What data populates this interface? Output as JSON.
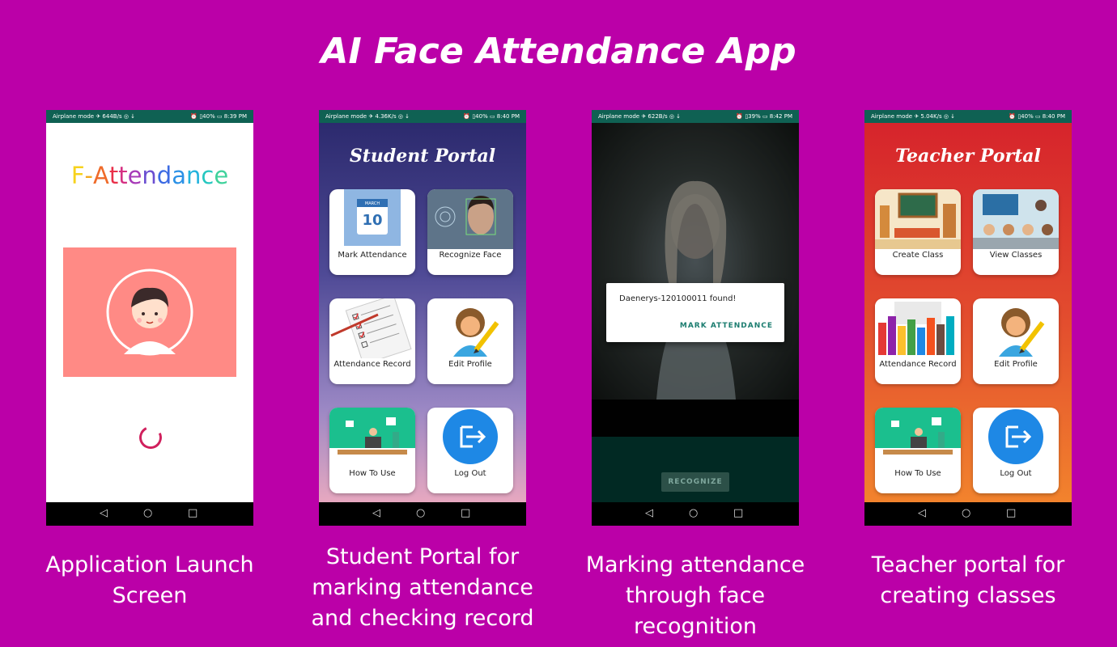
{
  "title": "AI Face Attendance App",
  "nav": {
    "back": "◁",
    "home": "○",
    "recent": "□"
  },
  "phones": [
    {
      "status_left": "Airplane mode ✈ 644B/s ◎ ↓",
      "status_right": "⏰ ▯40% ▭ 8:39 PM",
      "logo": "F-Attendance",
      "caption": "Application Launch Screen"
    },
    {
      "status_left": "Airplane mode ✈ 4.36K/s ◎ ↓",
      "status_right": "⏰ ▯40% ▭ 8:40 PM",
      "portal_title": "Student Portal",
      "tiles": [
        "Mark Attendance",
        "Recognize Face",
        "Attendance Record",
        "Edit Profile",
        "How To Use",
        "Log Out"
      ],
      "caption": "Student Portal for marking attendance and checking record"
    },
    {
      "status_left": "Airplane mode ✈ 622B/s ◎ ↓",
      "status_right": "⏰ ▯39% ▭ 8:42 PM",
      "dialog_message": "Daenerys-120100011 found!",
      "dialog_action": "MARK ATTENDANCE",
      "button": "RECOGNIZE",
      "caption": "Marking attendance through face recognition"
    },
    {
      "status_left": "Airplane mode ✈ 5.04K/s ◎ ↓",
      "status_right": "⏰ ▯40% ▭ 8:40 PM",
      "portal_title": "Teacher Portal",
      "tiles": [
        "Create Class",
        "View Classes",
        "Attendance Record",
        "Edit Profile",
        "How To Use",
        "Log Out"
      ],
      "caption": "Teacher portal for creating classes"
    }
  ],
  "icons": {
    "calendar_day": "10",
    "calendar_month": "MARCH"
  },
  "colors": {
    "background": "#bb00a8",
    "status_bar": "#0f6153",
    "avatar_box": "#ff8a85",
    "spinner": "#d0205d",
    "dialog_action": "#1c7d70"
  }
}
